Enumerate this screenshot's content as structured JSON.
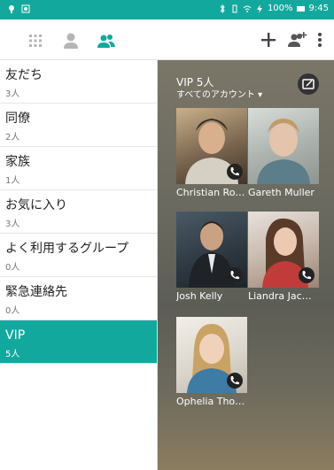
{
  "status_bar": {
    "battery": "100%",
    "time": "9:45"
  },
  "toolbar": {
    "tabs": [
      {
        "icon": "dialpad-icon"
      },
      {
        "icon": "person-icon"
      },
      {
        "icon": "group-icon",
        "active": true
      }
    ],
    "actions": [
      {
        "icon": "add-icon"
      },
      {
        "icon": "add-group-icon"
      },
      {
        "icon": "more-vert-icon"
      }
    ]
  },
  "groups": [
    {
      "name": "友だち",
      "count": "3人"
    },
    {
      "name": "同僚",
      "count": "2人"
    },
    {
      "name": "家族",
      "count": "1人"
    },
    {
      "name": "お気に入り",
      "count": "3人"
    },
    {
      "name": "よく利用するグループ",
      "count": "0人"
    },
    {
      "name": "緊急連絡先",
      "count": "0人"
    },
    {
      "name": "VIP",
      "count": "5人",
      "selected": true
    }
  ],
  "detail": {
    "title": "VIP 5人",
    "account_filter": "すべてのアカウント ▾",
    "contacts": [
      {
        "name": "Christian Ro…"
      },
      {
        "name": "Gareth Muller"
      },
      {
        "name": "Josh Kelly"
      },
      {
        "name": "Liandra Jac…"
      },
      {
        "name": "Ophelia Tho…"
      }
    ]
  },
  "colors": {
    "accent": "#13a89e"
  }
}
